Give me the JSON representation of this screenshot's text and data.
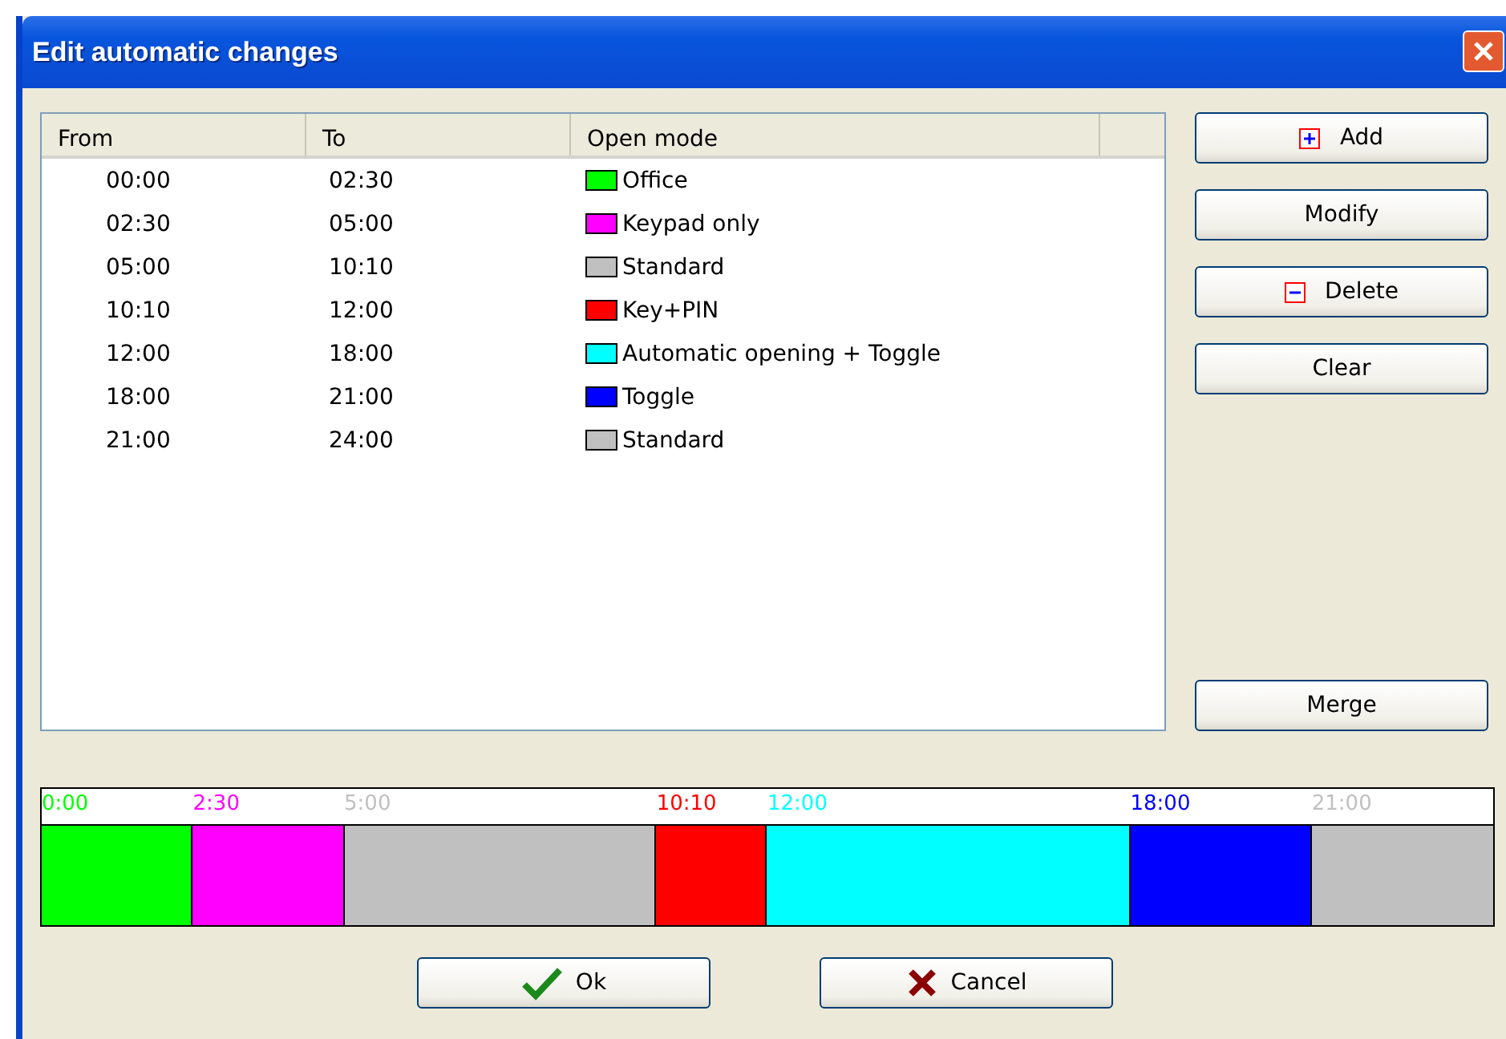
{
  "window": {
    "title": "Edit automatic changes"
  },
  "table": {
    "columns": [
      "From",
      "To",
      "Open mode"
    ],
    "rows": [
      {
        "from": "00:00",
        "to": "02:30",
        "mode": "Office",
        "color": "#00ff00"
      },
      {
        "from": "02:30",
        "to": "05:00",
        "mode": "Keypad only",
        "color": "#ff00ff"
      },
      {
        "from": "05:00",
        "to": "10:10",
        "mode": "Standard",
        "color": "#c0c0c0"
      },
      {
        "from": "10:10",
        "to": "12:00",
        "mode": "Key+PIN",
        "color": "#ff0000"
      },
      {
        "from": "12:00",
        "to": "18:00",
        "mode": "Automatic opening + Toggle",
        "color": "#00ffff"
      },
      {
        "from": "18:00",
        "to": "21:00",
        "mode": "Toggle",
        "color": "#0000ff"
      },
      {
        "from": "21:00",
        "to": "24:00",
        "mode": "Standard",
        "color": "#c0c0c0"
      }
    ]
  },
  "side_buttons": [
    {
      "label": "Add",
      "kind": "add"
    },
    {
      "label": "Modify",
      "kind": "plain"
    },
    {
      "label": "Delete",
      "kind": "delete"
    },
    {
      "label": "Clear",
      "kind": "plain"
    }
  ],
  "merge_button": "Merge",
  "timeline": {
    "labels": [
      "0:00",
      "2:30",
      "5:00",
      "10:10",
      "12:00",
      "18:00",
      "21:00"
    ]
  },
  "footer_buttons": [
    {
      "label": "Ok",
      "kind": "ok"
    },
    {
      "label": "Cancel",
      "kind": "cancel"
    }
  ]
}
